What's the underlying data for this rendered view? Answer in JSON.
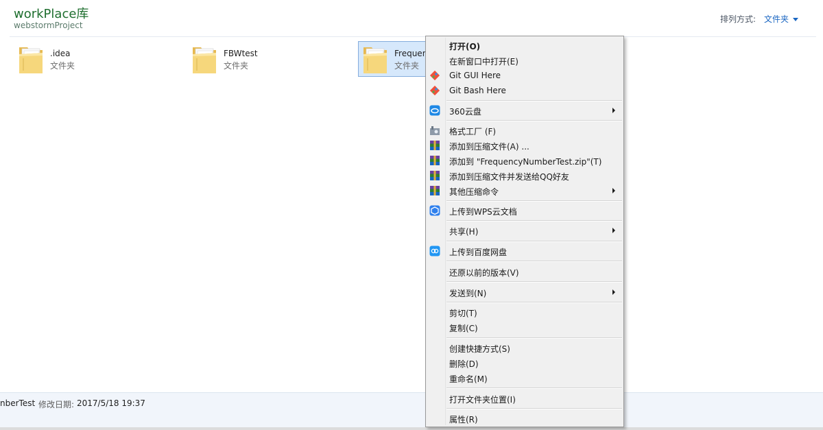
{
  "library": {
    "title": "workPlace库",
    "subtitle": "webstormProject",
    "sort_label": "排列方式:",
    "sort_value": "文件夹"
  },
  "folders": [
    {
      "name": ".idea",
      "type": "文件夹"
    },
    {
      "name": "FBWtest",
      "type": "文件夹"
    },
    {
      "name": "Frequen",
      "type": "文件夹"
    }
  ],
  "details": {
    "name": "nberTest",
    "date_label": "修改日期:",
    "date_value": "2017/5/18 19:37"
  },
  "context_menu": {
    "items": [
      {
        "label": "打开(O)",
        "icon": "none"
      },
      {
        "label": "在新窗口中打开(E)",
        "icon": "none"
      },
      {
        "label": "Git GUI Here",
        "icon": "git-icon"
      },
      {
        "label": "Git Bash Here",
        "icon": "git-icon"
      },
      {
        "label": "360云盘",
        "icon": "cloud-360-icon",
        "submenu": true
      },
      {
        "label": "格式工厂 (F)",
        "icon": "format-factory-icon"
      },
      {
        "label": "添加到压缩文件(A) ...",
        "icon": "winrar-icon"
      },
      {
        "label": "添加到 \"FrequencyNumberTest.zip\"(T)",
        "icon": "winrar-icon"
      },
      {
        "label": "添加到压缩文件并发送给QQ好友",
        "icon": "winrar-icon"
      },
      {
        "label": "其他压缩命令",
        "icon": "winrar-icon",
        "submenu": true
      },
      {
        "label": "上传到WPS云文档",
        "icon": "wps-cloud-icon"
      },
      {
        "label": "共享(H)",
        "icon": "none",
        "submenu": true
      },
      {
        "label": "上传到百度网盘",
        "icon": "baidu-netdisk-icon"
      },
      {
        "label": "还原以前的版本(V)",
        "icon": "none"
      },
      {
        "label": "发送到(N)",
        "icon": "none",
        "submenu": true
      },
      {
        "label": "剪切(T)",
        "icon": "none"
      },
      {
        "label": "复制(C)",
        "icon": "none"
      },
      {
        "label": "创建快捷方式(S)",
        "icon": "none"
      },
      {
        "label": "删除(D)",
        "icon": "none"
      },
      {
        "label": "重命名(M)",
        "icon": "none"
      },
      {
        "label": "打开文件夹位置(I)",
        "icon": "none"
      },
      {
        "label": "属性(R)",
        "icon": "none"
      }
    ]
  },
  "colors": {
    "library_title": "#1e6e2e",
    "link_blue": "#1a66c2",
    "selection_bg": "#d6e8fb",
    "menu_bg": "#f0f0f0"
  }
}
